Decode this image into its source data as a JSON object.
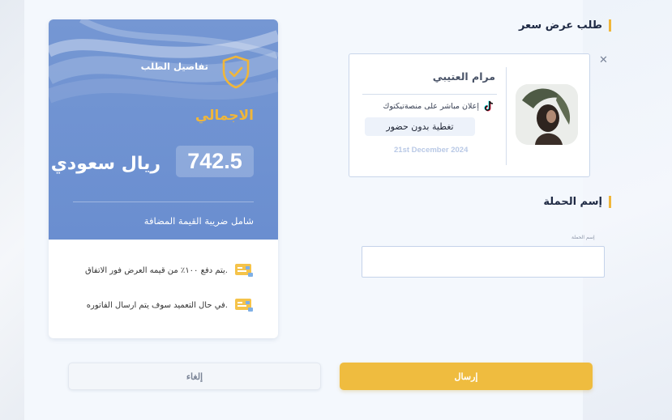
{
  "summary": {
    "details_title": "تفاصيل الطلب",
    "total_label": "الاجمالي",
    "amount": "742.5",
    "currency": "ريال سعودي",
    "vat_note": "شامل ضريبة القيمة المضافة",
    "notes": [
      ".يتم دفع ١٠٠٪ من قيمه العرض فور الاتفاق",
      ".في حال التعميد سوف يتم ارسال الفاتوره"
    ],
    "accent_color": "#f0b63a",
    "header_color": "#6a8ed0"
  },
  "quote": {
    "section_title": "طلب عرض سعر",
    "influencer_name": "مرام العتيبي",
    "platform_text": "إعلان مباشر على منصةتيكتوك",
    "coverage": "تغطية بدون حضور",
    "date": "21st December 2024",
    "close_icon": "close-icon"
  },
  "campaign": {
    "section_title": "إسم الحملة",
    "field_label": "إسم الحملة",
    "value": ""
  },
  "actions": {
    "submit_label": "إرسال",
    "cancel_label": "إلغاء",
    "submit_color": "#efbc3f"
  }
}
